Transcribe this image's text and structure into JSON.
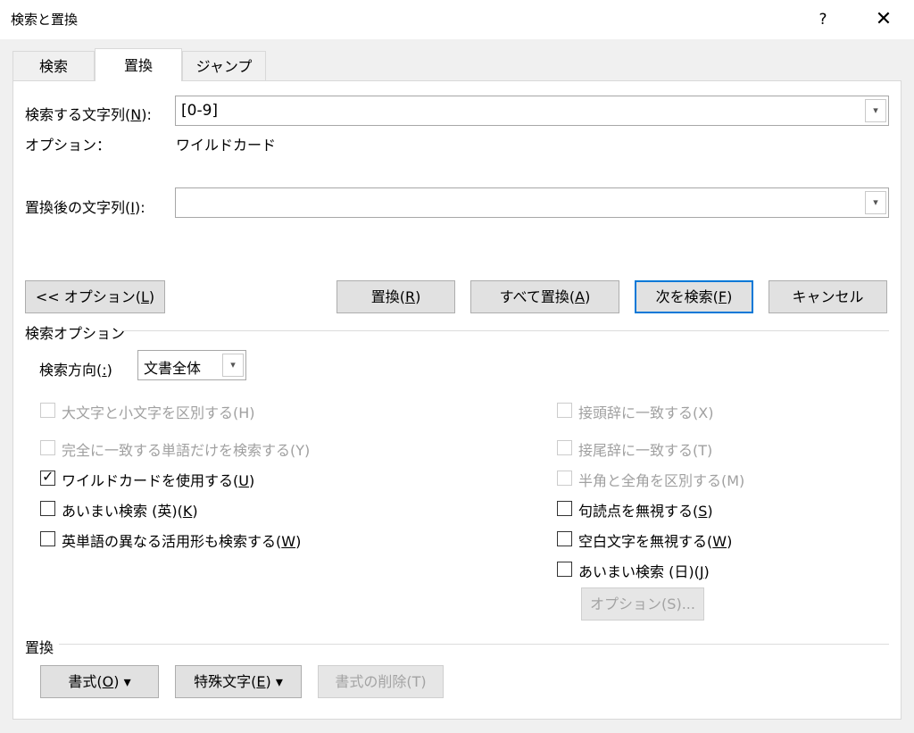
{
  "window": {
    "title": "検索と置換",
    "help": "?",
    "close": "✕"
  },
  "tabs": [
    {
      "label": "検索",
      "active": false
    },
    {
      "label": "置換",
      "active": true
    },
    {
      "label": "ジャンプ",
      "active": false
    }
  ],
  "find": {
    "label_pre": "検索する文字列(",
    "label_key": "N",
    "label_post": "):",
    "value": "[0-9]",
    "options_label": "オプション：",
    "options_value": "ワイルドカード"
  },
  "replace": {
    "label_pre": "置換後の文字列(",
    "label_key": "I",
    "label_post": "):",
    "value": ""
  },
  "buttons": {
    "options": {
      "pre": "<< オプション(",
      "key": "L",
      "post": ")"
    },
    "replace": {
      "pre": "置換(",
      "key": "R",
      "post": ")"
    },
    "replace_all": {
      "pre": "すべて置換(",
      "key": "A",
      "post": ")"
    },
    "find_next": {
      "pre": "次を検索(",
      "key": "F",
      "post": ")"
    },
    "cancel": {
      "label": "キャンセル"
    }
  },
  "search_options": {
    "header": "検索オプション",
    "direction_label_pre": "検索方向(",
    "direction_label_key": ":",
    "direction_label_post": ")",
    "direction_value": "文書全体",
    "left_checkboxes": [
      {
        "pre": "大文字と小文字を区別する(H)",
        "key": "",
        "post": "",
        "checked": false,
        "disabled": true
      },
      {
        "pre": "完全に一致する単語だけを検索する(Y)",
        "key": "",
        "post": "",
        "checked": false,
        "disabled": true
      },
      {
        "pre": "ワイルドカードを使用する(",
        "key": "U",
        "post": ")",
        "checked": true,
        "disabled": false
      },
      {
        "pre": "あいまい検索 (英)(",
        "key": "K",
        "post": ")",
        "checked": false,
        "disabled": false
      },
      {
        "pre": "英単語の異なる活用形も検索する(",
        "key": "W",
        "post": ")",
        "checked": false,
        "disabled": false
      }
    ],
    "right_checkboxes": [
      {
        "pre": "接頭辞に一致する(X)",
        "key": "",
        "post": "",
        "checked": false,
        "disabled": true
      },
      {
        "pre": "接尾辞に一致する(T)",
        "key": "",
        "post": "",
        "checked": false,
        "disabled": true
      },
      {
        "pre": "半角と全角を区別する(M)",
        "key": "",
        "post": "",
        "checked": false,
        "disabled": true
      },
      {
        "pre": "句読点を無視する(",
        "key": "S",
        "post": ")",
        "checked": false,
        "disabled": false
      },
      {
        "pre": "空白文字を無視する(",
        "key": "W",
        "post": ")",
        "checked": false,
        "disabled": false
      },
      {
        "pre": "あいまい検索 (日)(",
        "key": "J",
        "post": ")",
        "checked": false,
        "disabled": false
      }
    ],
    "fuzzy_options_button": "オプション(S)...",
    "check_mark": "✓"
  },
  "replace_section": {
    "header": "置換",
    "format": {
      "pre": "書式(",
      "key": "O",
      "post": ") ▾"
    },
    "special": {
      "pre": "特殊文字(",
      "key": "E",
      "post": ") ▾"
    },
    "no_format": "書式の削除(T)"
  }
}
